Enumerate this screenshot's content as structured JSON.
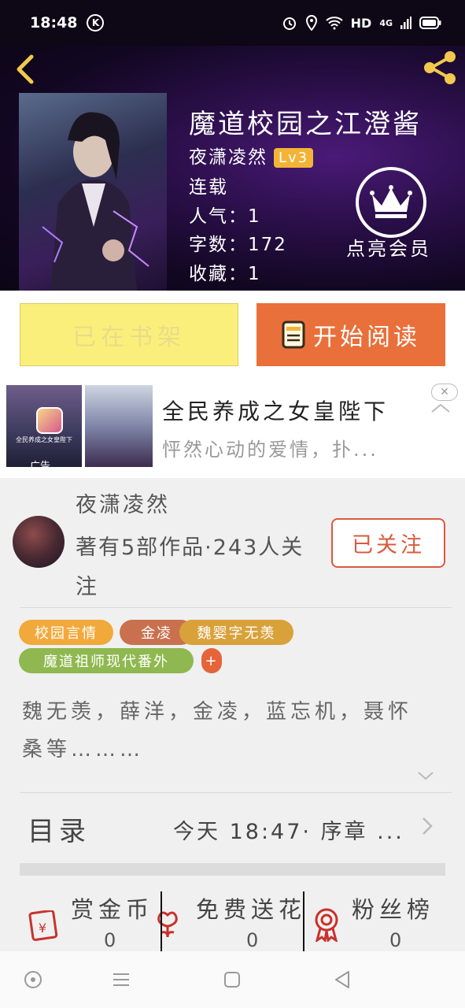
{
  "status": {
    "time": "18:48",
    "k_icon": "K",
    "hd": "HD",
    "network": "4G"
  },
  "book": {
    "title": "魔道校园之江澄酱",
    "author": "夜潇凌然",
    "level": "Lv3",
    "status": "连载",
    "popularity": "人气：1",
    "words": "字数：172",
    "favorites": "收藏：1",
    "vip_label": "点亮会员"
  },
  "actions": {
    "shelf_label": "已在书架",
    "read_label": "开始阅读"
  },
  "ad": {
    "title": "全民养成之女皇陛下",
    "desc": "怦然心动的爱情，扑...",
    "tag": "广告",
    "close_label": "✕",
    "mini_text": "全民养成之女皇陛下"
  },
  "author": {
    "name": "夜潇凌然",
    "stats": "著有5部作品·243人关注",
    "follow_label": "已关注"
  },
  "tags": [
    {
      "label": "校园言情",
      "color": "#f2a93b"
    },
    {
      "label": "金凌",
      "color": "#c9714f"
    },
    {
      "label": "魏婴字无羡",
      "color": "#d9a13a"
    },
    {
      "label": "魔道祖师现代番外",
      "color": "#8fb850"
    },
    {
      "label": "+",
      "color": "#e5643a"
    }
  ],
  "description": "魏无羡，薛洋，金凌，蓝忘机，聂怀桑等………",
  "catalog": {
    "label": "目录",
    "latest": "今天 18:47· 序章 ..."
  },
  "bottom_stats": [
    {
      "label": "赏金币",
      "value": "0",
      "icon": "red-envelope-icon"
    },
    {
      "label": "免费送花",
      "value": "0",
      "icon": "flower-icon"
    },
    {
      "label": "粉丝榜",
      "value": "0",
      "icon": "ribbon-award-icon"
    }
  ],
  "colors": {
    "accent": "#e9703a",
    "shelf": "#fbef7c",
    "follow": "#d95a3e",
    "icon_red": "#c8322c"
  }
}
